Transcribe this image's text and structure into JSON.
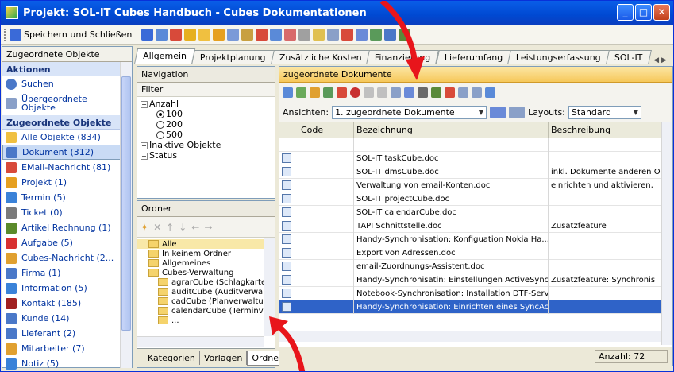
{
  "window": {
    "title": "Projekt: SOL-IT Cubes Handbuch - Cubes Dokumentationen"
  },
  "toolbar": {
    "save_label": "Speichern und Schließen"
  },
  "left": {
    "header": "Zugeordnete Objekte",
    "section_actions": "Aktionen",
    "actions": [
      {
        "label": "Suchen"
      },
      {
        "label": "Übergeordnete Objekte"
      }
    ],
    "section_objects": "Zugeordnete Objekte",
    "items": [
      {
        "label": "Alle Objekte (834)",
        "color": "#f0c040"
      },
      {
        "label": "Dokument (312)",
        "color": "#4a78c8"
      },
      {
        "label": "EMail-Nachricht (81)",
        "color": "#d84a3a"
      },
      {
        "label": "Projekt (1)",
        "color": "#e6a020"
      },
      {
        "label": "Termin (5)",
        "color": "#3a82d8"
      },
      {
        "label": "Ticket (0)",
        "color": "#7a7a7a"
      },
      {
        "label": "Artikel Rechnung (1)",
        "color": "#5a8a2a"
      },
      {
        "label": "Aufgabe (5)",
        "color": "#d83030"
      },
      {
        "label": "Cubes-Nachricht (2...",
        "color": "#e0a030"
      },
      {
        "label": "Firma (1)",
        "color": "#4a78c8"
      },
      {
        "label": "Information (5)",
        "color": "#3a82d8"
      },
      {
        "label": "Kontakt (185)",
        "color": "#a02020"
      },
      {
        "label": "Kunde (14)",
        "color": "#4a78c8"
      },
      {
        "label": "Lieferant (2)",
        "color": "#4a78c8"
      },
      {
        "label": "Mitarbeiter (7)",
        "color": "#e0a030"
      },
      {
        "label": "Notiz (5)",
        "color": "#3a82d8"
      }
    ]
  },
  "tabs": [
    "Allgemein",
    "Projektplanung",
    "Zusätzliche Kosten",
    "Finanzierung",
    "Lieferumfang",
    "Leistungserfassung",
    "SOL-IT"
  ],
  "navigation": {
    "title": "Navigation",
    "filter": "Filter",
    "anzahl": "Anzahl",
    "options": [
      "100",
      "200",
      "500"
    ],
    "inaktive": "Inaktive Objekte",
    "status": "Status"
  },
  "ordner": {
    "title": "Ordner",
    "folders": [
      "Alle",
      "In keinem Ordner",
      "Allgemeines",
      "Cubes-Verwaltung",
      "agrarCube (Schlagkartei)",
      "auditCube (Auditverwaltung)",
      "cadCube (Planverwaltung)",
      "calendarCube (Terminverwaltung)",
      "..."
    ],
    "bottom_tabs": [
      "Kategorien",
      "Vorlagen",
      "Ordner"
    ]
  },
  "docs": {
    "header": "zugeordnete Dokumente",
    "ansichten_label": "Ansichten:",
    "ansichten_value": "1. zugeordnete Dokumente",
    "layouts_label": "Layouts:",
    "layouts_value": "Standard",
    "columns": [
      "Code",
      "Bezeichnung",
      "Beschreibung"
    ],
    "rows": [
      {
        "code": "",
        "name": "SOL-IT taskCube.doc",
        "desc": ""
      },
      {
        "code": "",
        "name": "SOL-IT dmsCube.doc",
        "desc": "inkl. Dokumente anderen O"
      },
      {
        "code": "",
        "name": "Verwaltung von email-Konten.doc",
        "desc": "einrichten und aktivieren,"
      },
      {
        "code": "",
        "name": "SOL-IT projectCube.doc",
        "desc": ""
      },
      {
        "code": "",
        "name": "SOL-IT calendarCube.doc",
        "desc": ""
      },
      {
        "code": "",
        "name": "TAPI Schnittstelle.doc",
        "desc": "Zusatzfeature"
      },
      {
        "code": "",
        "name": "Handy-Synchronisation: Konfiguation Nokia Ha...",
        "desc": ""
      },
      {
        "code": "",
        "name": "Export von Adressen.doc",
        "desc": ""
      },
      {
        "code": "",
        "name": "email-Zuordnungs-Assistent.doc",
        "desc": ""
      },
      {
        "code": "",
        "name": "Handy-Synchronisatin: Einstellungen ActiveSync...",
        "desc": "Zusatzfeature: Synchronis"
      },
      {
        "code": "",
        "name": "Notebook-Synchronisation: Installation DTF-Serv...",
        "desc": ""
      },
      {
        "code": "",
        "name": "Handy-Synchronisation: Einrichten eines SyncAc...",
        "desc": ""
      }
    ],
    "count": "Anzahl: 72"
  }
}
